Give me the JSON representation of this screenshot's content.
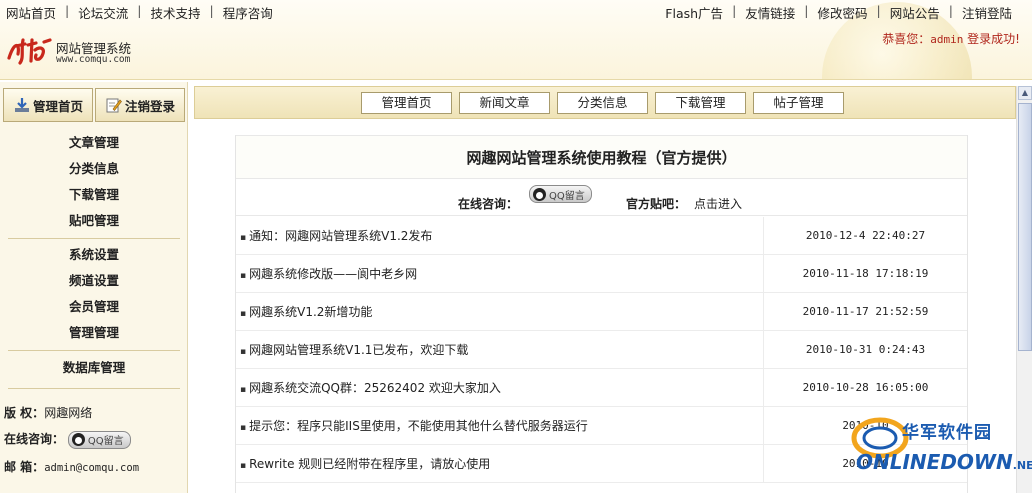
{
  "topnav": {
    "left": [
      "网站首页",
      "论坛交流",
      "技术支持",
      "程序咨询"
    ],
    "right": [
      "Flash广告",
      "友情链接",
      "修改密码",
      "网站公告",
      "注销登陆"
    ]
  },
  "brand": {
    "name": "网站管理系统",
    "url": "www.comqu.com"
  },
  "welcome": {
    "prefix": "恭喜您：",
    "user": "admin",
    "suffix": " 登录成功!"
  },
  "sidebar": {
    "buttons": [
      "管理首页",
      "注销登录"
    ],
    "group1": [
      "文章管理",
      "分类信息",
      "下载管理",
      "贴吧管理"
    ],
    "group2": [
      "系统设置",
      "频道设置",
      "会员管理",
      "管理管理"
    ],
    "group3": [
      "数据库管理"
    ],
    "copyright_label": "版 权：",
    "copyright_value": "网趣网络",
    "consult_label": "在线咨询：",
    "email_label": "邮 箱：",
    "email_value": "admin@comqu.com",
    "qq_badge": "QQ留言"
  },
  "tabs": [
    "管理首页",
    "新闻文章",
    "分类信息",
    "下载管理",
    "帖子管理"
  ],
  "panel": {
    "title": "网趣网站管理系统使用教程（官方提供）",
    "consult_label": "在线咨询：",
    "qq_badge": "QQ留言",
    "tieba_label": "官方贴吧：",
    "tieba_link": "点击进入"
  },
  "notices": [
    {
      "title": "通知：网趣网站管理系统V1.2发布",
      "date": "2010-12-4 22:40:27"
    },
    {
      "title": "网趣系统修改版——阆中老乡网",
      "date": "2010-11-18 17:18:19"
    },
    {
      "title": "网趣系统V1.2新增功能",
      "date": "2010-11-17 21:52:59"
    },
    {
      "title": "网趣网站管理系统V1.1已发布，欢迎下载",
      "date": "2010-10-31 0:24:43"
    },
    {
      "title": "网趣系统交流QQ群：25262402 欢迎大家加入",
      "date": "2010-10-28 16:05:00"
    },
    {
      "title": "提示您：程序只能IIS里使用，不能使用其他什么替代服务器运行",
      "date": "2010-10"
    },
    {
      "title": "Rewrite 规则已经附带在程序里，请放心使用",
      "date": "2010-10"
    }
  ],
  "watermark": {
    "cn": "华军软件园",
    "en": "ONLINEDOWN",
    "suffix": ".NET"
  },
  "colors": {
    "accent_red": "#b0261c",
    "header_bg": "#fbf4dc",
    "watermark_blue": "#1b5bb0"
  }
}
